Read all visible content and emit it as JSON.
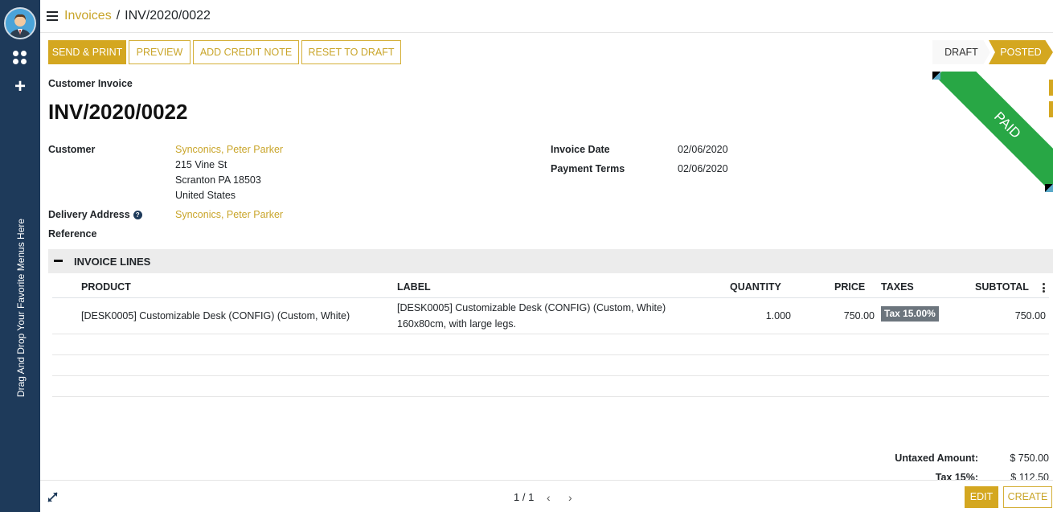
{
  "sidebar": {
    "favorites_hint": "Drag And Drop Your Favorite Menus Here"
  },
  "breadcrumb": {
    "parent": "Invoices",
    "separator": "/",
    "current": "INV/2020/0022"
  },
  "actions": {
    "send_print": "SEND & PRINT",
    "preview": "PREVIEW",
    "add_credit_note": "ADD CREDIT NOTE",
    "reset_to_draft": "RESET TO DRAFT"
  },
  "status": {
    "draft": "DRAFT",
    "posted": "POSTED",
    "ribbon": "PAID"
  },
  "form": {
    "doc_type": "Customer Invoice",
    "doc_number": "INV/2020/0022",
    "customer_label": "Customer",
    "customer_name": "Synconics, Peter Parker",
    "address_line1": "215 Vine St",
    "address_line2": "Scranton PA 18503",
    "address_line3": "United States",
    "delivery_label": "Delivery Address",
    "delivery_help": "?",
    "delivery_value": "Synconics, Peter Parker",
    "reference_label": "Reference",
    "invoice_date_label": "Invoice Date",
    "invoice_date": "02/06/2020",
    "payment_terms_label": "Payment Terms",
    "payment_terms": "02/06/2020"
  },
  "section": {
    "title": "INVOICE LINES"
  },
  "table": {
    "headers": {
      "product": "PRODUCT",
      "label": "LABEL",
      "quantity": "QUANTITY",
      "price": "PRICE",
      "taxes": "TAXES",
      "subtotal": "SUBTOTAL"
    },
    "rows": [
      {
        "product": "[DESK0005] Customizable Desk (CONFIG) (Custom, White)",
        "label_line1": "[DESK0005] Customizable Desk (CONFIG) (Custom, White)",
        "label_line2": "160x80cm, with large legs.",
        "quantity": "1.000",
        "price": "750.00",
        "tax": "Tax 15.00%",
        "subtotal": "750.00"
      }
    ]
  },
  "totals": {
    "untaxed_label": "Untaxed Amount:",
    "untaxed_value": "$ 750.00",
    "tax_label": "Tax 15%:",
    "tax_value": "$ 112.50"
  },
  "bottom": {
    "pager": "1 / 1",
    "prev": "‹",
    "next": "›",
    "edit": "EDIT",
    "create": "CREATE"
  }
}
